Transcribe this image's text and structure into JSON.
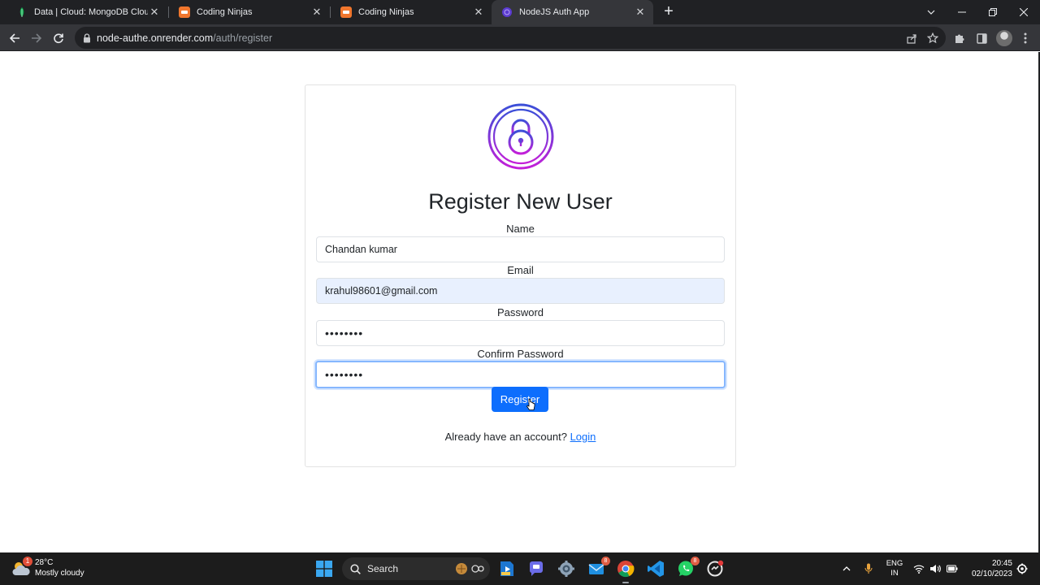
{
  "browser": {
    "tabs": [
      {
        "title": "Data | Cloud: MongoDB Cloud",
        "favicon": "mongodb-leaf-icon",
        "active": false
      },
      {
        "title": "Coding Ninjas",
        "favicon": "coding-ninjas-icon",
        "active": false
      },
      {
        "title": "Coding Ninjas",
        "favicon": "coding-ninjas-icon",
        "active": false
      },
      {
        "title": "NodeJS Auth App",
        "favicon": "globe-icon",
        "active": true
      }
    ],
    "url_host": "node-authe.onrender.com",
    "url_path": "/auth/register",
    "icons": [
      "back-icon",
      "forward-icon",
      "reload-icon",
      "lock-icon",
      "share-icon",
      "star-icon",
      "extensions-icon",
      "side-panel-icon",
      "profile-avatar",
      "menu-icon"
    ]
  },
  "page": {
    "title": "Register New User",
    "logo": "padlock-logo-icon",
    "accent_color": "#0d6efd",
    "fields": {
      "name": {
        "label": "Name",
        "value": "Chandan kumar"
      },
      "email": {
        "label": "Email",
        "value": "krahul98601@gmail.com"
      },
      "password": {
        "label": "Password",
        "value": "••••••••"
      },
      "confirm": {
        "label": "Confirm Password",
        "value": "••••••••"
      }
    },
    "register_label": "Register",
    "footer_text": "Already have an account?",
    "login_link": "Login"
  },
  "taskbar": {
    "weather": {
      "temp": "28°C",
      "desc": "Mostly cloudy",
      "badge": "1"
    },
    "search_label": "Search",
    "apps": [
      {
        "name": "media-player-icon"
      },
      {
        "name": "teams-chat-icon"
      },
      {
        "name": "settings-icon"
      },
      {
        "name": "mail-icon",
        "badge": "8"
      },
      {
        "name": "chrome-icon"
      },
      {
        "name": "vscode-icon"
      },
      {
        "name": "whatsapp-icon",
        "badge": "8"
      },
      {
        "name": "github-desktop-icon"
      }
    ],
    "lang_top": "ENG",
    "lang_bottom": "IN",
    "time": "20:45",
    "date": "02/10/2023"
  }
}
